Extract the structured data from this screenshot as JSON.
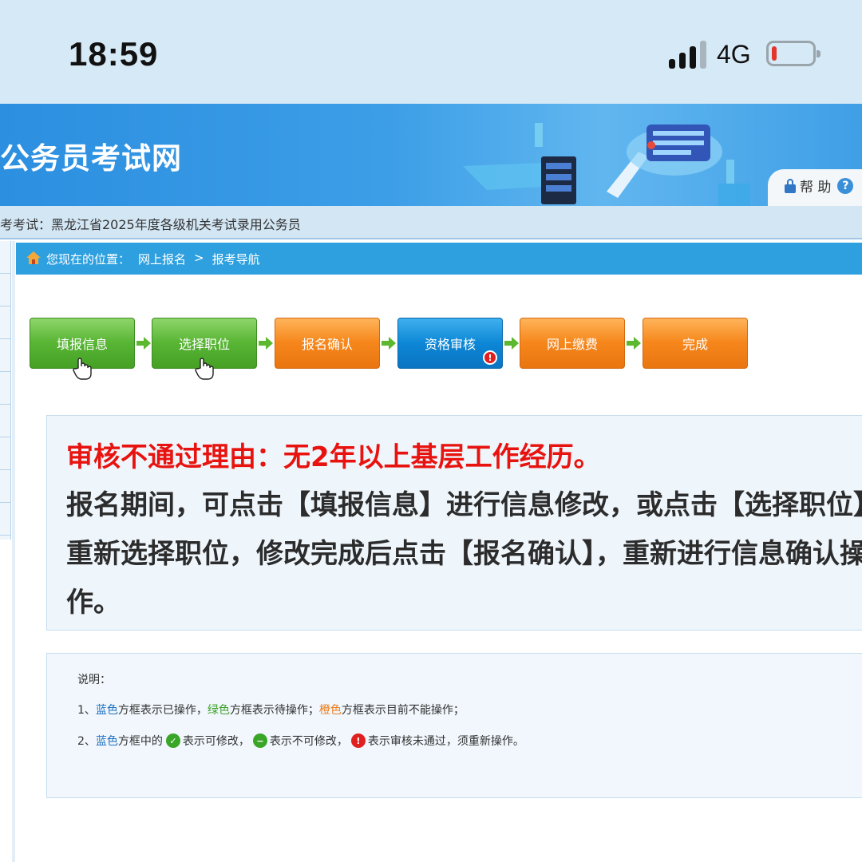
{
  "status_bar": {
    "time": "18:59",
    "network": "4G",
    "battery_level": 0.12
  },
  "header": {
    "site_title": "公务员考试网",
    "help_label": "帮 助",
    "exam_line": "考考试：黑龙江省2025年度各级机关考试录用公务员"
  },
  "breadcrumb": {
    "prefix": "您现在的位置：",
    "items": [
      "网上报名",
      ">",
      "报考导航"
    ]
  },
  "steps": [
    {
      "label": "填报信息",
      "state": "green"
    },
    {
      "label": "选择职位",
      "state": "green"
    },
    {
      "label": "报名确认",
      "state": "orange"
    },
    {
      "label": "资格审核",
      "state": "blue"
    },
    {
      "label": "网上缴费",
      "state": "orange"
    },
    {
      "label": "完成",
      "state": "orange"
    }
  ],
  "message": {
    "reason": "审核不通过理由：无2年以上基层工作经历。",
    "instruction": "报名期间，可点击【填报信息】进行信息修改，或点击【选择职位】重新选择职位，修改完成后点击【报名确认】，重新进行信息确认操作。"
  },
  "notes": {
    "title": "说明：",
    "line1": {
      "num": "1、",
      "blue": "蓝色",
      "t1": "方框表示已操作，",
      "green": "绿色",
      "t2": "方框表示待操作；",
      "orange": "橙色",
      "t3": "方框表示目前不能操作；"
    },
    "line2": {
      "num": "2、",
      "blue": "蓝色",
      "t1": "方框中的",
      "t2": "表示可修改，",
      "t3": "表示不可修改，",
      "t4": "表示审核未通过，须重新操作。"
    }
  },
  "colors": {
    "accent": "#2ea0df",
    "reason_red": "#e8130f",
    "step_green": "#59b635",
    "step_orange": "#f6871c",
    "step_blue": "#0d87d6"
  }
}
